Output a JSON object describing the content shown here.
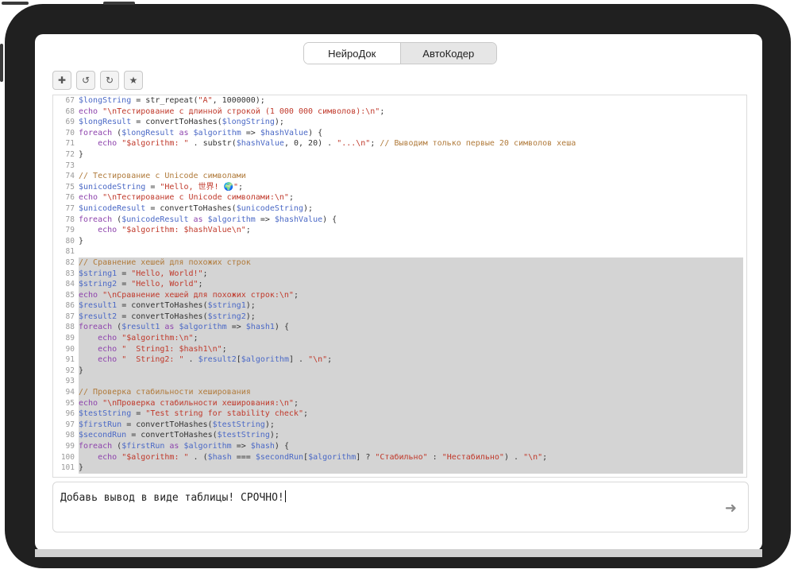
{
  "tabs": [
    {
      "label": "НейроДок",
      "active": true
    },
    {
      "label": "АвтоКодер",
      "active": false
    }
  ],
  "toolbar": {
    "buttons": [
      {
        "icon": "plus-icon",
        "glyph": "✚"
      },
      {
        "icon": "undo-icon",
        "glyph": "↺"
      },
      {
        "icon": "redo-icon",
        "glyph": "↻"
      },
      {
        "icon": "star-icon",
        "glyph": "★"
      }
    ]
  },
  "code": {
    "lines": [
      {
        "n": "67",
        "sel": false,
        "tokens": [
          [
            "var",
            "$longString"
          ],
          [
            "fn",
            " = str_repeat("
          ],
          [
            "str",
            "\"A\""
          ],
          [
            "fn",
            ", 1000000);"
          ]
        ]
      },
      {
        "n": "68",
        "sel": false,
        "tokens": [
          [
            "kw",
            "echo"
          ],
          [
            "fn",
            " "
          ],
          [
            "str",
            "\"\\nТестирование с длинной строкой (1 000 000 символов):\\n\""
          ],
          [
            "fn",
            ";"
          ]
        ]
      },
      {
        "n": "69",
        "sel": false,
        "tokens": [
          [
            "var",
            "$longResult"
          ],
          [
            "fn",
            " = convertToHashes("
          ],
          [
            "var",
            "$longString"
          ],
          [
            "fn",
            ");"
          ]
        ]
      },
      {
        "n": "70",
        "sel": false,
        "tokens": [
          [
            "kw",
            "foreach"
          ],
          [
            "fn",
            " ("
          ],
          [
            "var",
            "$longResult"
          ],
          [
            "kw",
            " as "
          ],
          [
            "var",
            "$algorithm"
          ],
          [
            "fn",
            " => "
          ],
          [
            "var",
            "$hashValue"
          ],
          [
            "fn",
            ") {"
          ]
        ]
      },
      {
        "n": "71",
        "sel": false,
        "tokens": [
          [
            "fn",
            "    "
          ],
          [
            "kw",
            "echo"
          ],
          [
            "fn",
            " "
          ],
          [
            "str",
            "\"$algorithm: \""
          ],
          [
            "fn",
            " . substr("
          ],
          [
            "var",
            "$hashValue"
          ],
          [
            "fn",
            ", 0, 20) . "
          ],
          [
            "str",
            "\"...\\n\""
          ],
          [
            "fn",
            "; "
          ],
          [
            "cm",
            "// Выводим только первые 20 символов хеша"
          ]
        ]
      },
      {
        "n": "72",
        "sel": false,
        "tokens": [
          [
            "fn",
            "}"
          ]
        ]
      },
      {
        "n": "73",
        "sel": false,
        "tokens": []
      },
      {
        "n": "74",
        "sel": false,
        "tokens": [
          [
            "cm",
            "// Тестирование с Unicode символами"
          ]
        ]
      },
      {
        "n": "75",
        "sel": false,
        "tokens": [
          [
            "var",
            "$unicodeString"
          ],
          [
            "fn",
            " = "
          ],
          [
            "str",
            "\"Hello, 世界! 🌍\""
          ],
          [
            "fn",
            ";"
          ]
        ]
      },
      {
        "n": "76",
        "sel": false,
        "tokens": [
          [
            "kw",
            "echo"
          ],
          [
            "fn",
            " "
          ],
          [
            "str",
            "\"\\nТестирование с Unicode символами:\\n\""
          ],
          [
            "fn",
            ";"
          ]
        ]
      },
      {
        "n": "77",
        "sel": false,
        "tokens": [
          [
            "var",
            "$unicodeResult"
          ],
          [
            "fn",
            " = convertToHashes("
          ],
          [
            "var",
            "$unicodeString"
          ],
          [
            "fn",
            ");"
          ]
        ]
      },
      {
        "n": "78",
        "sel": false,
        "tokens": [
          [
            "kw",
            "foreach"
          ],
          [
            "fn",
            " ("
          ],
          [
            "var",
            "$unicodeResult"
          ],
          [
            "kw",
            " as "
          ],
          [
            "var",
            "$algorithm"
          ],
          [
            "fn",
            " => "
          ],
          [
            "var",
            "$hashValue"
          ],
          [
            "fn",
            ") {"
          ]
        ]
      },
      {
        "n": "79",
        "sel": false,
        "tokens": [
          [
            "fn",
            "    "
          ],
          [
            "kw",
            "echo"
          ],
          [
            "fn",
            " "
          ],
          [
            "str",
            "\"$algorithm: $hashValue\\n\""
          ],
          [
            "fn",
            ";"
          ]
        ]
      },
      {
        "n": "80",
        "sel": false,
        "tokens": [
          [
            "fn",
            "}"
          ]
        ]
      },
      {
        "n": "81",
        "sel": false,
        "tokens": []
      },
      {
        "n": "82",
        "sel": true,
        "tokens": [
          [
            "cm",
            "// Сравнение хешей для похожих строк"
          ]
        ]
      },
      {
        "n": "83",
        "sel": true,
        "tokens": [
          [
            "var",
            "$string1"
          ],
          [
            "fn",
            " = "
          ],
          [
            "str",
            "\"Hello, World!\""
          ],
          [
            "fn",
            ";"
          ]
        ]
      },
      {
        "n": "84",
        "sel": true,
        "tokens": [
          [
            "var",
            "$string2"
          ],
          [
            "fn",
            " = "
          ],
          [
            "str",
            "\"Hello, World\""
          ],
          [
            "fn",
            ";"
          ]
        ]
      },
      {
        "n": "85",
        "sel": true,
        "tokens": [
          [
            "kw",
            "echo"
          ],
          [
            "fn",
            " "
          ],
          [
            "str",
            "\"\\nСравнение хешей для похожих строк:\\n\""
          ],
          [
            "fn",
            ";"
          ]
        ]
      },
      {
        "n": "86",
        "sel": true,
        "tokens": [
          [
            "var",
            "$result1"
          ],
          [
            "fn",
            " = convertToHashes("
          ],
          [
            "var",
            "$string1"
          ],
          [
            "fn",
            ");"
          ]
        ]
      },
      {
        "n": "87",
        "sel": true,
        "tokens": [
          [
            "var",
            "$result2"
          ],
          [
            "fn",
            " = convertToHashes("
          ],
          [
            "var",
            "$string2"
          ],
          [
            "fn",
            ");"
          ]
        ]
      },
      {
        "n": "88",
        "sel": true,
        "tokens": [
          [
            "kw",
            "foreach"
          ],
          [
            "fn",
            " ("
          ],
          [
            "var",
            "$result1"
          ],
          [
            "kw",
            " as "
          ],
          [
            "var",
            "$algorithm"
          ],
          [
            "fn",
            " => "
          ],
          [
            "var",
            "$hash1"
          ],
          [
            "fn",
            ") {"
          ]
        ]
      },
      {
        "n": "89",
        "sel": true,
        "tokens": [
          [
            "fn",
            "    "
          ],
          [
            "kw",
            "echo"
          ],
          [
            "fn",
            " "
          ],
          [
            "str",
            "\"$algorithm:\\n\""
          ],
          [
            "fn",
            ";"
          ]
        ]
      },
      {
        "n": "90",
        "sel": true,
        "tokens": [
          [
            "fn",
            "    "
          ],
          [
            "kw",
            "echo"
          ],
          [
            "fn",
            " "
          ],
          [
            "str",
            "\"  String1: $hash1\\n\""
          ],
          [
            "fn",
            ";"
          ]
        ]
      },
      {
        "n": "91",
        "sel": true,
        "tokens": [
          [
            "fn",
            "    "
          ],
          [
            "kw",
            "echo"
          ],
          [
            "fn",
            " "
          ],
          [
            "str",
            "\"  String2: \""
          ],
          [
            "fn",
            " . "
          ],
          [
            "var",
            "$result2"
          ],
          [
            "fn",
            "["
          ],
          [
            "var",
            "$algorithm"
          ],
          [
            "fn",
            "] . "
          ],
          [
            "str",
            "\"\\n\""
          ],
          [
            "fn",
            ";"
          ]
        ]
      },
      {
        "n": "92",
        "sel": true,
        "tokens": [
          [
            "fn",
            "}"
          ]
        ]
      },
      {
        "n": "93",
        "sel": true,
        "tokens": []
      },
      {
        "n": "94",
        "sel": true,
        "tokens": [
          [
            "cm",
            "// Проверка стабильности хеширования"
          ]
        ]
      },
      {
        "n": "95",
        "sel": true,
        "tokens": [
          [
            "kw",
            "echo"
          ],
          [
            "fn",
            " "
          ],
          [
            "str",
            "\"\\nПроверка стабильности хеширования:\\n\""
          ],
          [
            "fn",
            ";"
          ]
        ]
      },
      {
        "n": "96",
        "sel": true,
        "tokens": [
          [
            "var",
            "$testString"
          ],
          [
            "fn",
            " = "
          ],
          [
            "str",
            "\"Test string for stability check\""
          ],
          [
            "fn",
            ";"
          ]
        ]
      },
      {
        "n": "97",
        "sel": true,
        "tokens": [
          [
            "var",
            "$firstRun"
          ],
          [
            "fn",
            " = convertToHashes("
          ],
          [
            "var",
            "$testString"
          ],
          [
            "fn",
            ");"
          ]
        ]
      },
      {
        "n": "98",
        "sel": true,
        "tokens": [
          [
            "var",
            "$secondRun"
          ],
          [
            "fn",
            " = convertToHashes("
          ],
          [
            "var",
            "$testString"
          ],
          [
            "fn",
            ");"
          ]
        ]
      },
      {
        "n": "99",
        "sel": true,
        "tokens": [
          [
            "kw",
            "foreach"
          ],
          [
            "fn",
            " ("
          ],
          [
            "var",
            "$firstRun"
          ],
          [
            "kw",
            " as "
          ],
          [
            "var",
            "$algorithm"
          ],
          [
            "fn",
            " => "
          ],
          [
            "var",
            "$hash"
          ],
          [
            "fn",
            ") {"
          ]
        ]
      },
      {
        "n": "100",
        "sel": true,
        "tokens": [
          [
            "fn",
            "    "
          ],
          [
            "kw",
            "echo"
          ],
          [
            "fn",
            " "
          ],
          [
            "str",
            "\"$algorithm: \""
          ],
          [
            "fn",
            " . ("
          ],
          [
            "var",
            "$hash"
          ],
          [
            "fn",
            " === "
          ],
          [
            "var",
            "$secondRun"
          ],
          [
            "fn",
            "["
          ],
          [
            "var",
            "$algorithm"
          ],
          [
            "fn",
            "] ? "
          ],
          [
            "str",
            "\"Стабильно\""
          ],
          [
            "fn",
            " : "
          ],
          [
            "str",
            "\"Нестабильно\""
          ],
          [
            "fn",
            ") . "
          ],
          [
            "str",
            "\"\\n\""
          ],
          [
            "fn",
            ";"
          ]
        ]
      },
      {
        "n": "101",
        "sel": true,
        "tokens": [
          [
            "fn",
            "}"
          ]
        ]
      }
    ]
  },
  "prompt": {
    "value": "Добавь вывод в виде таблицы! СРОЧНО!",
    "send_icon": "arrow-right-icon",
    "send_glyph": "➜"
  }
}
